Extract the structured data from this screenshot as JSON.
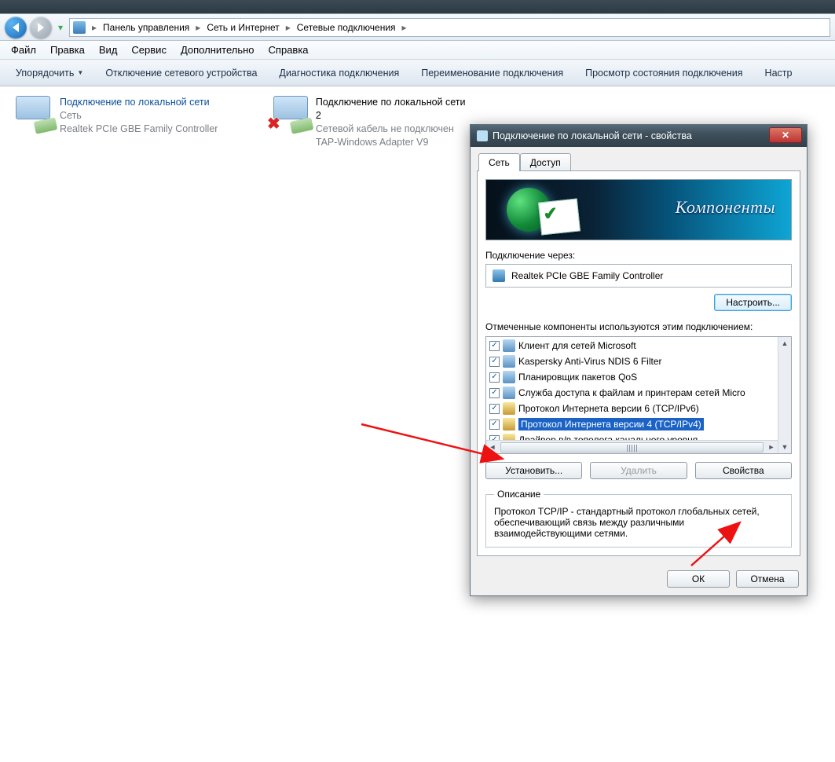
{
  "breadcrumb": {
    "items": [
      "Панель управления",
      "Сеть и Интернет",
      "Сетевые подключения"
    ]
  },
  "menu": {
    "items": [
      "Файл",
      "Правка",
      "Вид",
      "Сервис",
      "Дополнительно",
      "Справка"
    ]
  },
  "toolbar": {
    "items": [
      "Упорядочить",
      "Отключение сетевого устройства",
      "Диагностика подключения",
      "Переименование подключения",
      "Просмотр состояния подключения",
      "Настр"
    ]
  },
  "connections": {
    "c1": {
      "title": "Подключение по локальной сети",
      "status": "Сеть",
      "device": "Realtek PCIe GBE Family Controller"
    },
    "c2": {
      "title": "Подключение по локальной сети 2",
      "status": "Сетевой кабель не подключен",
      "device": "TAP-Windows Adapter V9"
    }
  },
  "dialog": {
    "title": "Подключение по локальной сети - свойства",
    "tabs": {
      "net": "Сеть",
      "access": "Доступ"
    },
    "banner_text": "Компоненты",
    "connect_via_label": "Подключение через:",
    "adapter": "Realtek PCIe GBE Family Controller",
    "configure_btn": "Настроить...",
    "components_label": "Отмеченные компоненты используются этим подключением:",
    "components": [
      {
        "checked": true,
        "label": "Клиент для сетей Microsoft",
        "icon": "net"
      },
      {
        "checked": true,
        "label": "Kaspersky Anti-Virus NDIS 6 Filter",
        "icon": "net"
      },
      {
        "checked": true,
        "label": "Планировщик пакетов QoS",
        "icon": "net"
      },
      {
        "checked": true,
        "label": "Служба доступа к файлам и принтерам сетей Micro",
        "icon": "net"
      },
      {
        "checked": true,
        "label": "Протокол Интернета версии 6 (TCP/IPv6)",
        "icon": "proto"
      },
      {
        "checked": true,
        "label": "Протокол Интернета версии 4 (TCP/IPv4)",
        "icon": "proto",
        "selected": true
      },
      {
        "checked": true,
        "label": "Драйвер в/в тополога канального уровня",
        "icon": "proto"
      }
    ],
    "install_btn": "Установить...",
    "remove_btn": "Удалить",
    "props_btn": "Свойства",
    "desc_legend": "Описание",
    "desc_text": "Протокол TCP/IP - стандартный протокол глобальных сетей, обеспечивающий связь между различными взаимодействующими сетями.",
    "ok_btn": "ОК",
    "cancel_btn": "Отмена"
  }
}
